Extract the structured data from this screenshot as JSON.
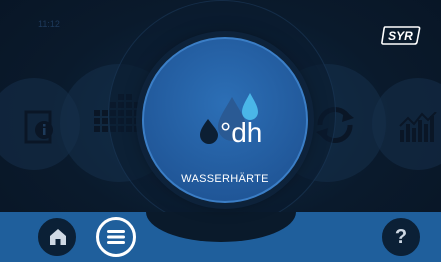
{
  "status": {
    "time": "11:12"
  },
  "brand": {
    "logo_text": "SYR"
  },
  "carousel": {
    "current": {
      "unit_label": "°dh",
      "title": "WASSERHÄRTE",
      "icon": "water-drops-icon"
    },
    "left_items": [
      {
        "icon": "info-document-icon"
      },
      {
        "icon": "calendar-grid-icon"
      }
    ],
    "right_items": [
      {
        "icon": "refresh-cycle-icon"
      },
      {
        "icon": "bar-chart-icon"
      }
    ]
  },
  "bottom_nav": {
    "home_icon": "home-icon",
    "menu_icon": "menu-icon",
    "help_label": "?"
  },
  "colors": {
    "background": "#0a1a2b",
    "accent": "#1f5f9c",
    "main_circle": "#2660a6",
    "drop_dark": "#0c1f33",
    "drop_light": "#4ab6e8"
  }
}
